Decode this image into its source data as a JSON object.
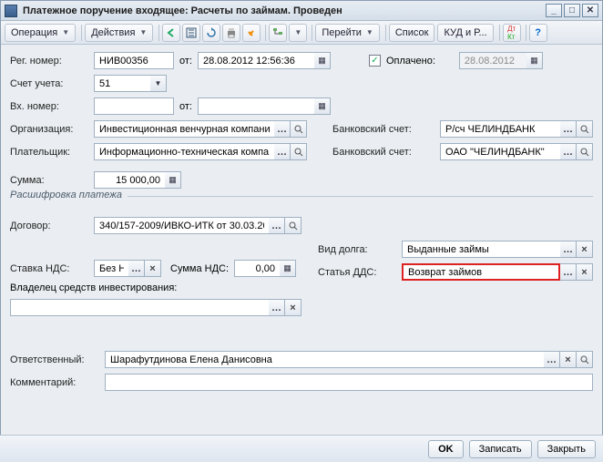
{
  "window": {
    "title": "Платежное поручение входящее: Расчеты по займам. Проведен"
  },
  "toolbar": {
    "operation": "Операция",
    "actions": "Действия",
    "goto": "Перейти",
    "list": "Список",
    "kudir": "КУД и Р...",
    "dtkt": "Дт Кт"
  },
  "fields": {
    "reg_no_label": "Рег. номер:",
    "reg_no": "НИВ00356",
    "ot": "от:",
    "reg_date": "28.08.2012 12:56:36",
    "paid_label": "Оплачено:",
    "paid_date": "28.08.2012",
    "acct_label": "Счет учета:",
    "acct": "51",
    "in_no_label": "Вх. номер:",
    "in_no": "",
    "in_date": "",
    "org_label": "Организация:",
    "org": "Инвестиционная венчурная компани",
    "payer_label": "Плательщик:",
    "payer": "Информационно-техническая компа",
    "bank1_label": "Банковский счет:",
    "bank1": "Р/сч ЧЕЛИНДБАНК",
    "bank2_label": "Банковский счет:",
    "bank2": "ОАО \"ЧЕЛИНДБАНК\"",
    "sum_label": "Сумма:",
    "sum": "15 000,00",
    "decode_label": "Расшифровка платежа",
    "contract_label": "Договор:",
    "contract": "340/157-2009/ИВКО-ИТК от 30.03.20",
    "vat_rate_label": "Ставка НДС:",
    "vat_rate": "Без Н",
    "vat_sum_label": "Сумма НДС:",
    "vat_sum": "0,00",
    "debt_label": "Вид долга:",
    "debt": "Выданные займы",
    "dds_label": "Статья ДДС:",
    "dds": "Возврат займов",
    "owner_label": "Владелец средств инвестирования:",
    "owner": "",
    "resp_label": "Ответственный:",
    "resp": "Шарафутдинова Елена Данисовна",
    "comment_label": "Комментарий:",
    "comment": ""
  },
  "buttons": {
    "ok": "OK",
    "save": "Записать",
    "close": "Закрыть"
  }
}
